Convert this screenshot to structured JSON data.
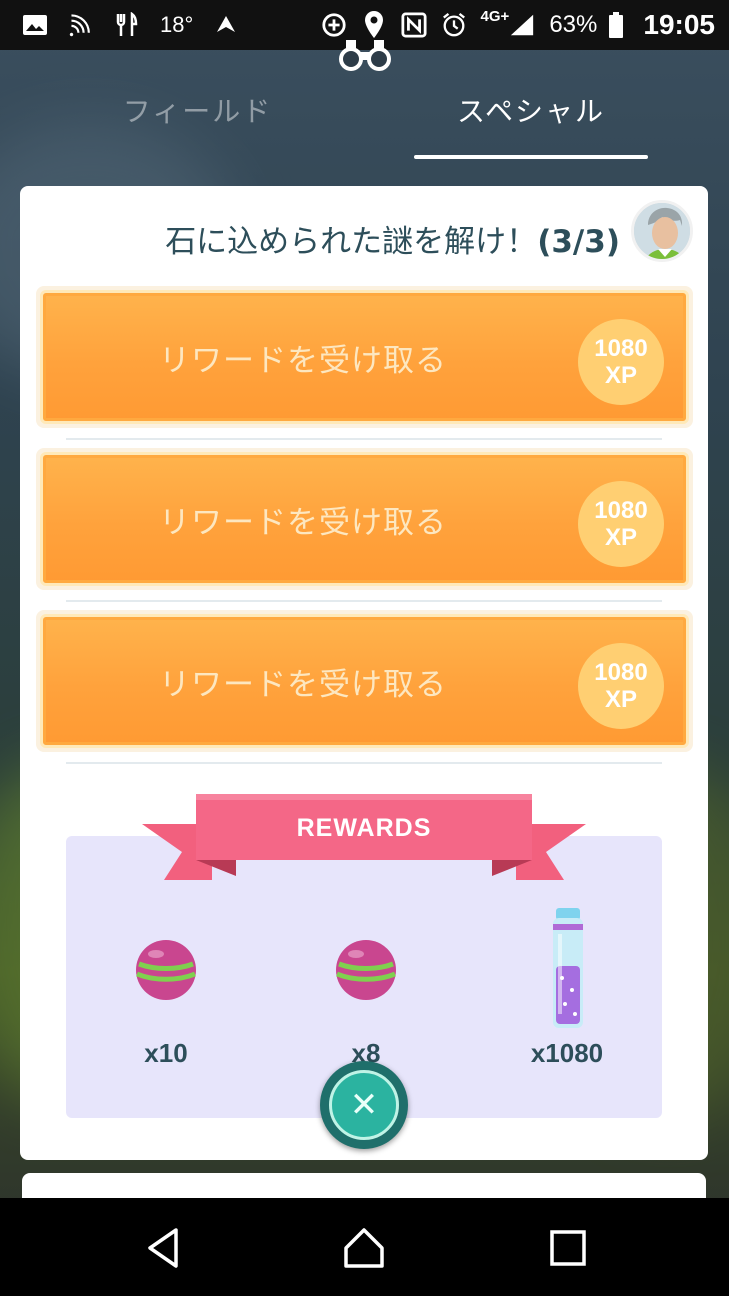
{
  "status_bar": {
    "temperature": "18°",
    "network": "4G+",
    "battery": "63%",
    "time": "19:05",
    "icons": [
      "image-icon",
      "nfc-wave-icon",
      "restaurant-icon",
      "temperature-icon",
      "send-icon",
      "data-saver-icon",
      "location-icon",
      "nfc-icon",
      "alarm-icon",
      "signal-icon",
      "battery-icon"
    ]
  },
  "tabs": [
    {
      "label": "フィールド",
      "active": false
    },
    {
      "label": "スペシャル",
      "active": true
    }
  ],
  "research": {
    "title": "石に込められた謎を解け！",
    "progress": "(3/3)",
    "tasks": [
      {
        "label": "リワードを受け取る",
        "xp_amount": "1080",
        "xp_unit": "XP"
      },
      {
        "label": "リワードを受け取る",
        "xp_amount": "1080",
        "xp_unit": "XP"
      },
      {
        "label": "リワードを受け取る",
        "xp_amount": "1080",
        "xp_unit": "XP"
      }
    ]
  },
  "rewards": {
    "header": "REWARDS",
    "items": [
      {
        "icon": "great-ball-icon",
        "quantity": "x10"
      },
      {
        "icon": "great-ball-icon",
        "quantity": "x8"
      },
      {
        "icon": "stardust-bottle-icon",
        "quantity": "x1080"
      }
    ]
  },
  "colors": {
    "accent_orange": "#ffa23c",
    "title_text": "#2d4e5a",
    "ribbon_pink": "#f2607e",
    "close_teal": "#2bb3a0"
  }
}
